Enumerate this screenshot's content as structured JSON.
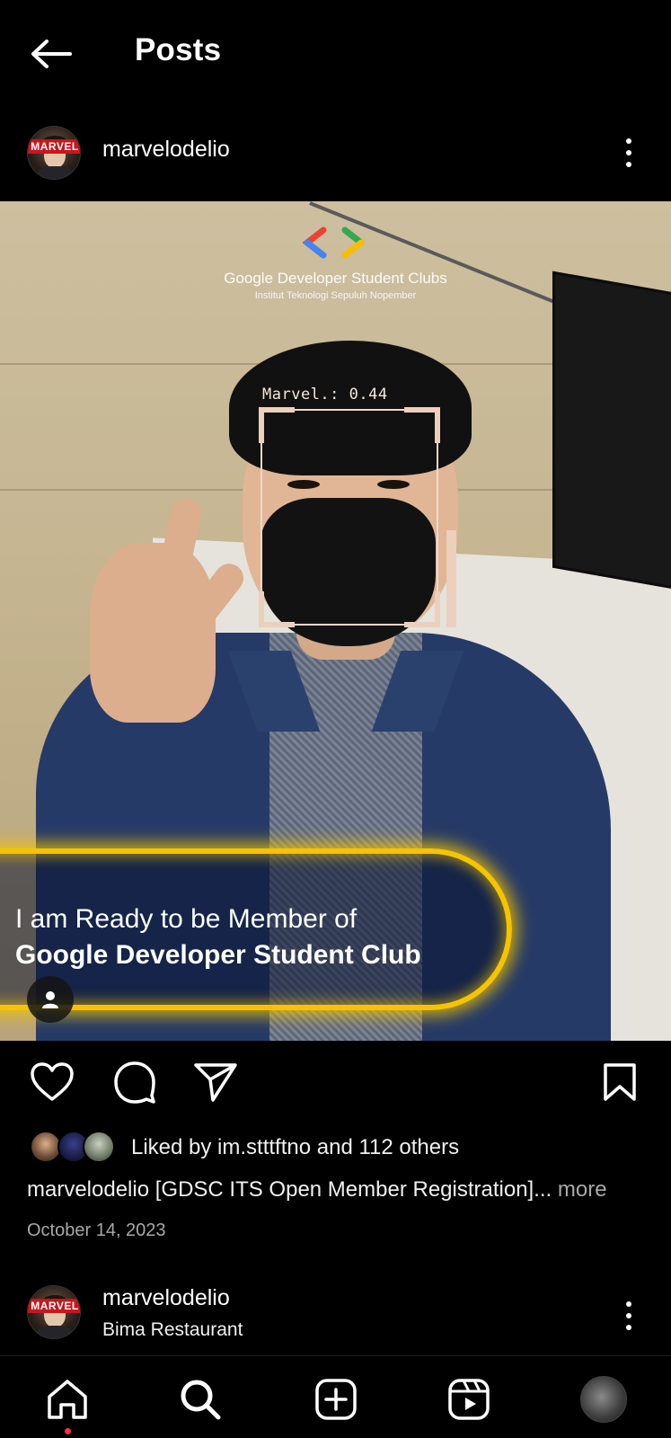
{
  "header": {
    "back_icon": "arrow-left-icon",
    "title": "Posts"
  },
  "post": {
    "username": "marvelodelio",
    "avatar_badge": "MARVEL",
    "more_icon": "more-vertical-icon",
    "media": {
      "org_title": "Google Developer Student Clubs",
      "org_subtitle": "Institut Teknologi Sepuluh Nopember",
      "detection_label": "Marvel.: 0.44",
      "banner_line1": "I am Ready to be Member of",
      "banner_line2": "Google Developer Student Club",
      "tag_icon": "user-tag-icon"
    },
    "actions": {
      "like_icon": "heart-icon",
      "comment_icon": "comment-icon",
      "share_icon": "send-icon",
      "save_icon": "bookmark-icon"
    },
    "likes_text": "Liked by im.stttftno and 112 others",
    "caption_user": "marvelodelio",
    "caption_text": " [GDSC ITS Open Member Registration]...",
    "caption_more": " more",
    "date": "October 14, 2023"
  },
  "next_post": {
    "username": "marvelodelio",
    "location": "Bima Restaurant"
  },
  "bottom_nav": {
    "items": [
      "home-icon",
      "search-icon",
      "create-icon",
      "reels-icon",
      "profile-avatar"
    ]
  },
  "colors": {
    "background": "#000000",
    "text": "#ffffff",
    "muted": "#a8a8a8",
    "notification": "#ff3040",
    "banner_glow": "#f5c400"
  }
}
